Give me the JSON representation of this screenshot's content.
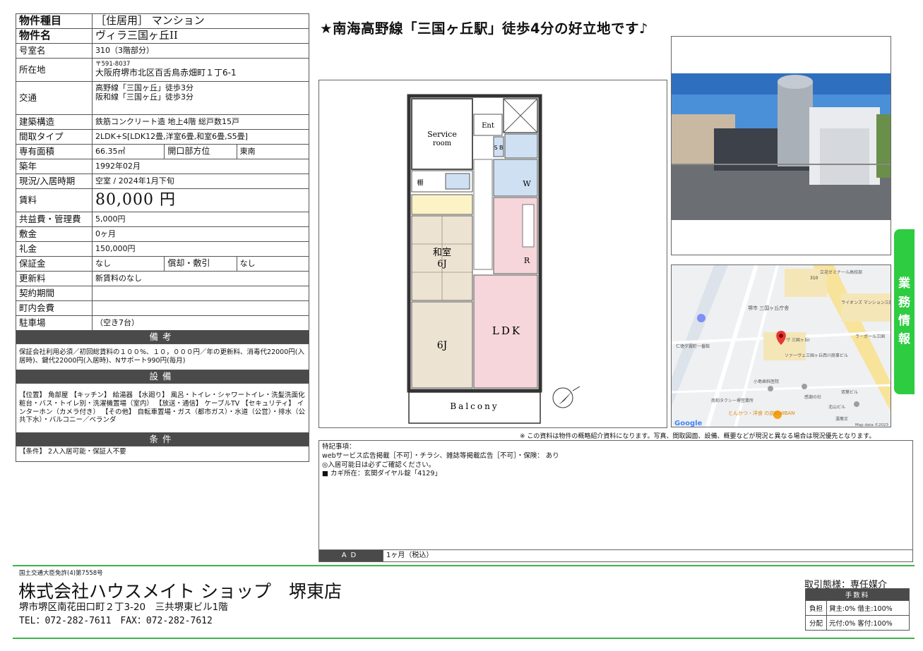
{
  "spec": {
    "type_label": "物件種目",
    "type_value": "［住居用］ マンション",
    "name_label": "物件名",
    "name_value": "ヴィラ三国ヶ丘II",
    "room_label": "号室名",
    "room_value": "310（3階部分）",
    "addr_label": "所在地",
    "zip": "〒591-8037",
    "addr_value": "大阪府堺市北区百舌鳥赤畑町１丁6-1",
    "access_label": "交通",
    "access_1": "高野線「三国ヶ丘」徒歩3分",
    "access_2": "阪和線「三国ヶ丘」徒歩3分",
    "struct_label": "建築構造",
    "struct_value": "鉄筋コンクリート造 地上4階 総戸数15戸",
    "layout_label": "間取タイプ",
    "layout_value": "2LDK+S[LDK12畳,洋室6畳,和室6畳,S5畳]",
    "area_label": "専有面積",
    "area_value": "66.35㎡",
    "open_label": "開口部方位",
    "open_value": "東南",
    "built_label": "築年",
    "built_value": "1992年02月",
    "status_label": "現況/入居時期",
    "status_value": "空室 / 2024年1月下旬",
    "rent_label": "賃料",
    "rent_value": "80,000 円",
    "fee_label": "共益費・管理費",
    "fee_value": "5,000円",
    "deposit_label": "敷金",
    "deposit_value": "0ヶ月",
    "key_label": "礼金",
    "key_value": "150,000円",
    "guarantee_label": "保証金",
    "guarantee_value": "なし",
    "amort_label": "償却・敷引",
    "amort_value": "なし",
    "renew_label": "更新料",
    "renew_value": "新賃料のなし",
    "contract_label": "契約期間",
    "contract_value": "",
    "town_label": "町内会費",
    "town_value": "",
    "parking_label": "駐車場",
    "parking_value": "（空き7台）",
    "remarks_header": "備考",
    "remarks_text": "保証会社利用必須／初回総賃料の１００%、１０，０００円／年の更新料、消毒代22000円(入居時)、鍵代22000円(入居時)、Nサポート990円(毎月)",
    "equip_header": "設備",
    "equip_text": "【位置】 角部屋 【キッチン】 給湯器 【水廻り】 風呂・トイレ・シャワートイレ・洗髪洗面化粧台・バス・トイレ別・洗濯機置場（室内） 【放送・通信】 ケーブルTV 【セキュリティ】 インターホン（カメラ付き） 【その他】 自転車置場・ガス（都市ガス）・水道（公営）・排水（公共下水）・バルコニー／ベランダ",
    "cond_header": "条件",
    "cond_text": "【条件】 2人入居可能・保証人不要"
  },
  "headline": "★南海高野線「三国ヶ丘駅」徒歩4分の好立地です♪",
  "floorplan": {
    "service_room": "Service room",
    "ent": "Ent",
    "sb": "S B",
    "w": "W",
    "shelf": "棚",
    "r": "R",
    "washitsu": "和室",
    "washitsu_size": "6J",
    "youshitsu_size": "6J",
    "ldk": "LDK",
    "balcony": "Balcony"
  },
  "map": {
    "labels": [
      "立花ゼミナール高校部",
      "ライオンズ マンション三国ヶ丘",
      "堺市 三国ヶ丘庁舎",
      "ヴ 三国ヶ丘I",
      "ラ・ポール三国",
      "仁徳夕霧町一番館",
      "ソァーヴェ三国ヶ丘",
      "西川商事ビル",
      "小島歯科医院",
      "双葉ビル",
      "南和タクシー堺営業所",
      "感謝の社",
      "北山ビル",
      "とんかつ・洋食 の店ICHIBAN",
      "湯葉正",
      "310"
    ],
    "google": "Google",
    "credit": "Map data ©2023"
  },
  "side_tab": [
    "業",
    "務",
    "情",
    "報"
  ],
  "disclaimer": "※ この資料は物件の概略紹介資料になります。写真、間取図面、設備、概要などが現況と異なる場合は現況優先となります。",
  "notes": {
    "title": "特記事項：",
    "line1": "webサービス広告掲載［不可］・チラシ、雑誌等掲載広告［不可］・保険： あり",
    "line2": "◎入居可能日は必ずご確認ください。",
    "line3": "■ カギ所在：玄関ダイヤル錠「4129」",
    "ad_label": "AD",
    "ad_value": "1ヶ月（税込）"
  },
  "footer": {
    "license": "国土交通大臣免許(4)第7558号",
    "company": "株式会社ハウスメイト ショップ　堺東店",
    "address": "堺市堺区南花田口町２丁3-20　三共堺東ビル1階",
    "tel": "TEL：072-282-7611　FAX：072-282-7612",
    "deal_type": "取引態様：専任媒介",
    "fee_header": "手数料",
    "burden_label": "負担",
    "burden_value": "貸主:0% 借主:100%",
    "split_label": "分配",
    "split_value": "元付:0% 客付:100%"
  },
  "colors": {
    "accent_green": "#3cb44b",
    "header_gray": "#4a4a4a",
    "ldk_pink": "#f6d6da",
    "room_beige": "#ede3d2",
    "bath_blue": "#cfe0f3",
    "closet_yellow": "#fbf3c6"
  }
}
